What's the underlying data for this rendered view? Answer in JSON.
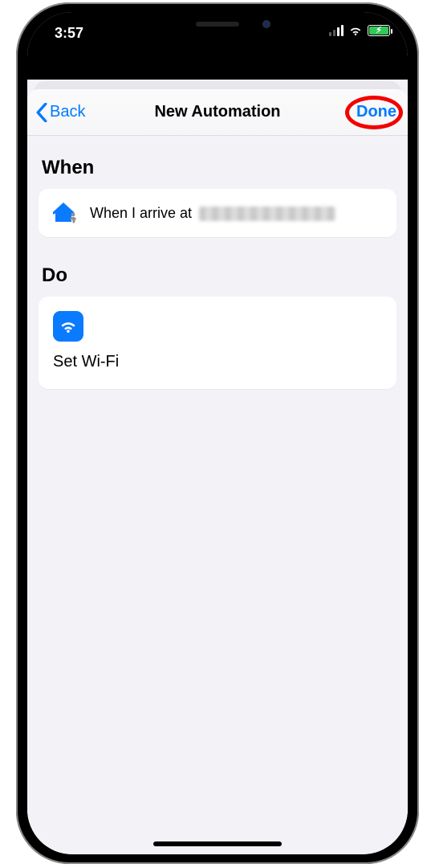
{
  "statusbar": {
    "time": "3:57"
  },
  "navbar": {
    "back_label": "Back",
    "title": "New Automation",
    "done_label": "Done"
  },
  "sections": {
    "when": {
      "header": "When",
      "row_prefix": "When I arrive at"
    },
    "do": {
      "header": "Do",
      "action_title": "Set Wi-Fi"
    }
  }
}
